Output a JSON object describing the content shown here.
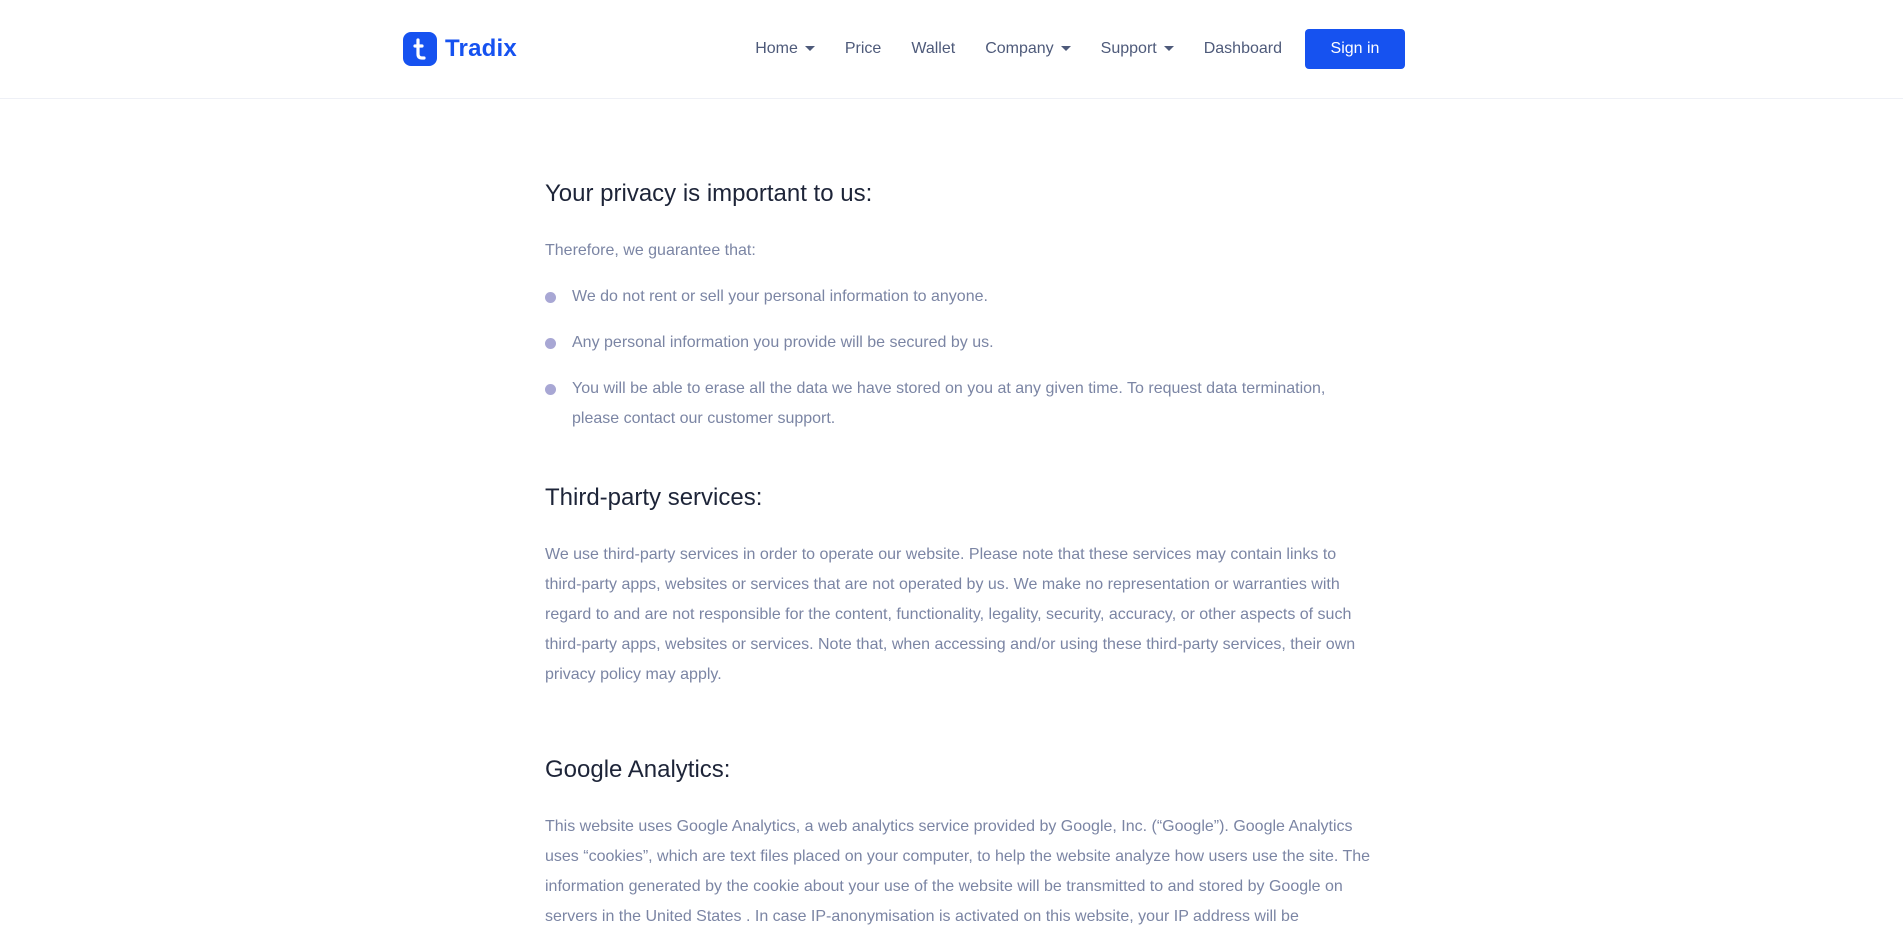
{
  "brand": {
    "name": "Tradix",
    "color": "#1652f0"
  },
  "nav": {
    "items": [
      {
        "label": "Home",
        "dropdown": true
      },
      {
        "label": "Price",
        "dropdown": false
      },
      {
        "label": "Wallet",
        "dropdown": false
      },
      {
        "label": "Company",
        "dropdown": true
      },
      {
        "label": "Support",
        "dropdown": true
      },
      {
        "label": "Dashboard",
        "dropdown": false
      }
    ],
    "signin_label": "Sign in"
  },
  "privacy": {
    "heading": "Your privacy is important to us:",
    "intro": "Therefore, we guarantee that:",
    "bullets": [
      "We do not rent or sell your personal information to anyone.",
      "Any personal information you provide will be secured by us.",
      "You will be able to erase all the data we have stored on you at any given time. To request data termination, please contact our customer support."
    ]
  },
  "third_party": {
    "heading": "Third-party services:",
    "body": "We use third-party services in order to operate our website. Please note that these services may contain links to third-party apps, websites or services that are not operated by us. We make no representation or warranties with regard to and are not responsible for the content, functionality, legality, security, accuracy, or other aspects of such third-party apps, websites or services. Note that, when accessing and/or using these third-party services, their own privacy policy may apply."
  },
  "google_analytics": {
    "heading": "Google Analytics:",
    "body": "This website uses Google Analytics, a web analytics service provided by Google, Inc. (“Google”). Google Analytics uses “cookies”, which are text files placed on your computer, to help the website analyze how users use the site. The information generated by the cookie about your use of the website will be transmitted to and stored by Google on servers in the United States . In case IP-anonymisation is activated on this website, your IP address will be"
  }
}
